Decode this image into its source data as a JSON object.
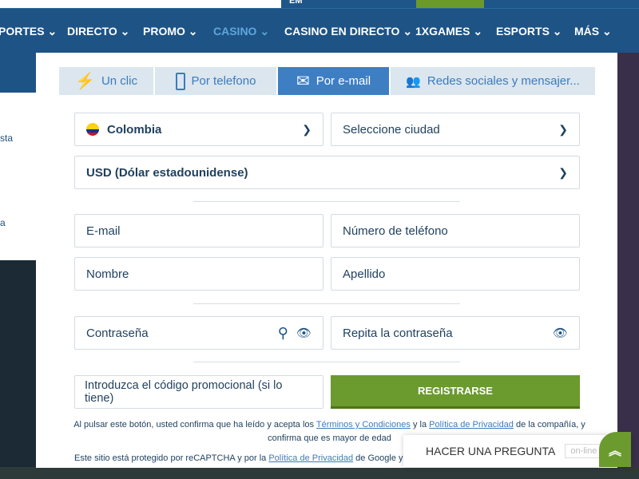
{
  "topbar": {
    "em_label": "EM"
  },
  "nav": {
    "items": [
      {
        "label": "PORTES ⌄",
        "active": false
      },
      {
        "label": "DIRECTO ⌄",
        "active": false
      },
      {
        "label": "PROMO ⌄",
        "active": false
      },
      {
        "label": "CASINO ⌄",
        "active": true
      },
      {
        "label": "CASINO EN DIRECTO ⌄",
        "active": false
      },
      {
        "label": "1XGAMES ⌄",
        "active": false
      },
      {
        "label": "ESPORTS ⌄",
        "active": false
      },
      {
        "label": "MÁS ⌄",
        "active": false
      }
    ]
  },
  "left_panel": {
    "text1": "sta",
    "text2": "a"
  },
  "tabs": [
    {
      "label": "Un clic",
      "icon": "lightning-icon"
    },
    {
      "label": "Por telefono",
      "icon": "phone-icon"
    },
    {
      "label": "Por e-mail",
      "icon": "envelope-icon",
      "active": true
    },
    {
      "label": "Redes sociales y mensajer...",
      "icon": "users-icon"
    }
  ],
  "form": {
    "country": "Colombia",
    "city_placeholder": "Seleccione ciudad",
    "currency": "USD (Dólar estadounidense)",
    "email_placeholder": "E-mail",
    "phone_placeholder": "Número de teléfono",
    "name_placeholder": "Nombre",
    "surname_placeholder": "Apellido",
    "password_placeholder": "Contraseña",
    "repeat_password_placeholder": "Repita la contraseña",
    "promo_placeholder": "Introduzca el código promocional (si lo tiene)",
    "register_label": "REGISTRARSE"
  },
  "legal": {
    "pre": "Al pulsar este botón, usted confirma que ha leído y acepta los ",
    "terms": "Términos y Condiciones",
    "mid": " y la ",
    "privacy": "Política de Privacidad",
    "post": " de la compañía, y confirma que es mayor de edad"
  },
  "recaptcha": {
    "pre": "Este sitio está protegido por reCAPTCHA y por la ",
    "privacy": "Política de Privacidad",
    "post": " de Google y se"
  },
  "chat": {
    "label": "HACER UNA PREGUNTA",
    "status": "on-line"
  },
  "colors": {
    "nav": "#1e5385",
    "accent": "#3e7fc3",
    "green": "#6b9a2e"
  }
}
